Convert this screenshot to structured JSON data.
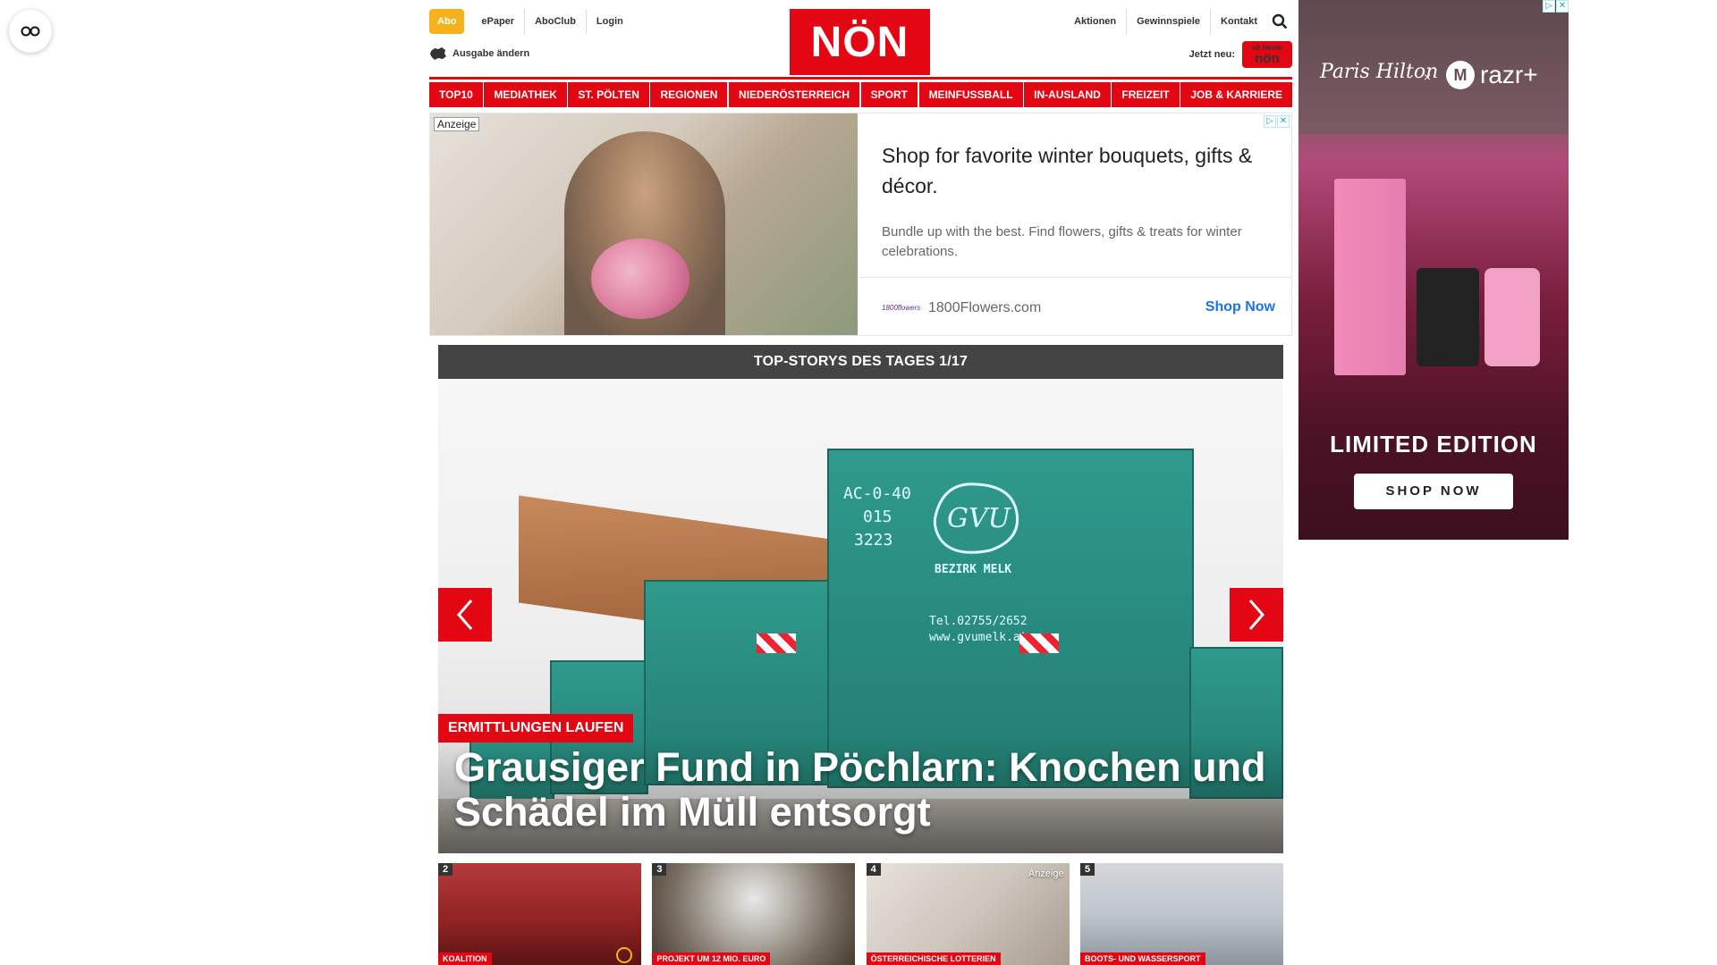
{
  "header": {
    "abo_label": "Abo",
    "left_links": [
      "ePaper",
      "AboClub",
      "Login"
    ],
    "edition_label": "Ausgabe ändern",
    "logo_text": "NÖN",
    "right_links": [
      "Aktionen",
      "Gewinnspiele",
      "Kontakt"
    ],
    "jetzt_neu_label": "Jetzt neu:",
    "jetzt_badge_small": "ab Heute",
    "jetzt_badge_large": "nön"
  },
  "nav": {
    "items": [
      "TOP10",
      "MEDIATHEK",
      "ST. PÖLTEN",
      "REGIONEN",
      "NIEDERÖSTERREICH",
      "SPORT",
      "MEINFUSSBALL",
      "IN-AUSLAND",
      "FREIZEIT",
      "JOB & KARRIERE"
    ]
  },
  "ad_banner": {
    "badge": "Anzeige",
    "title": "Shop for favorite winter bouquets, gifts & décor.",
    "description": "Bundle up with the best. Find flowers, gifts & treats for winter celebrations.",
    "brand": "1800Flowers.com",
    "cta": "Shop Now"
  },
  "topstories": {
    "header": "TOP-STORYS DES TAGES 1/17",
    "hero": {
      "tag": "ERMITTLUNGEN LAUFEN",
      "headline": "Grausiger Fund in Pöchlarn: Knochen und Schädel im Müll entsorgt",
      "container_id_lines": [
        "AC-0-40",
        "015",
        "3223"
      ],
      "container_brand": "BEZIRK MELK",
      "container_phone": "Tel.02755/2652",
      "container_web": "www.gvumelk.at"
    },
    "thumbnails": [
      {
        "num": "2",
        "label": "KOALITION",
        "anzeige": ""
      },
      {
        "num": "3",
        "label": "PROJEKT UM 12 MIO. EURO",
        "anzeige": ""
      },
      {
        "num": "4",
        "label": "ÖSTERREICHISCHE LOTTERIEN",
        "anzeige": "Anzeige"
      },
      {
        "num": "5",
        "label": "BOOTS- UND WASSERSPORT",
        "anzeige": ""
      }
    ]
  },
  "side_ad": {
    "brand_left": "Paris Hilton",
    "brand_x": "×",
    "brand_right": "razr+",
    "headline": "LIMITED EDITION",
    "cta": "SHOP NOW"
  },
  "colors": {
    "brand_red": "#e30613",
    "abo_yellow": "#f6b21b",
    "storybar_gray": "#444444",
    "ad_link_blue": "#1a73e8"
  }
}
